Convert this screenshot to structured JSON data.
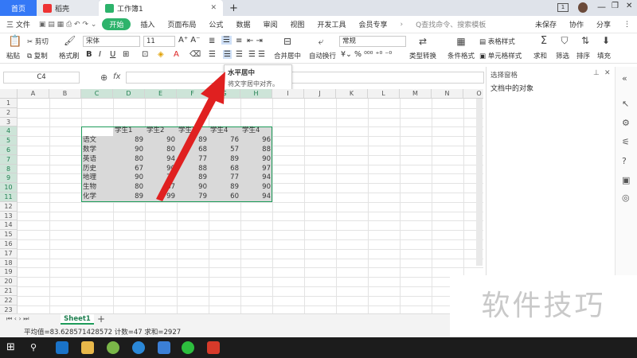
{
  "titlebar": {
    "home_tab": "首页",
    "wps_tab": "稻壳",
    "book_tab": "工作簿1",
    "new_tab": "+",
    "badge": "1"
  },
  "menubar": {
    "file": "三 文件",
    "start": "开始",
    "items": [
      "插入",
      "页面布局",
      "公式",
      "数据",
      "审阅",
      "视图",
      "开发工具",
      "会员专享"
    ],
    "search_placeholder": "Q查找命令、搜索模板",
    "unsaved": "未保存",
    "collab": "协作",
    "share": "分享"
  },
  "toolbar": {
    "paste": "粘贴",
    "cut": "剪切",
    "copy": "复制",
    "format_painter": "格式刷",
    "font_name": "宋体",
    "font_size": "11",
    "merge_center": "合并居中",
    "wrap": "自动换行",
    "number_format": "常规",
    "type_convert": "类型转换",
    "cond_format": "条件格式",
    "table_style": "表格样式",
    "cell_style": "单元格样式",
    "sum": "求和",
    "filter": "筛选",
    "sort": "排序",
    "fill": "填充"
  },
  "tooltip": {
    "title": "水平居中",
    "desc": "将文字居中对齐。"
  },
  "formula_bar": {
    "cell_ref": "C4",
    "fx": "fx"
  },
  "grid": {
    "columns": [
      "A",
      "B",
      "C",
      "D",
      "E",
      "F",
      "G",
      "H",
      "I",
      "J",
      "K",
      "L",
      "M",
      "N",
      "O"
    ],
    "rows": [
      "1",
      "2",
      "3",
      "4",
      "5",
      "6",
      "7",
      "8",
      "9",
      "10",
      "11",
      "12",
      "13",
      "14",
      "15",
      "16",
      "17",
      "18",
      "19",
      "20",
      "21",
      "22",
      "23"
    ],
    "headers": [
      "学生1",
      "学生2",
      "学生3",
      "学生4",
      "学生4"
    ],
    "data": [
      {
        "subject": "语文",
        "values": [
          "89",
          "90",
          "89",
          "76",
          "96"
        ]
      },
      {
        "subject": "数学",
        "values": [
          "90",
          "80",
          "68",
          "57",
          "88"
        ]
      },
      {
        "subject": "英语",
        "values": [
          "80",
          "94",
          "77",
          "89",
          "90"
        ]
      },
      {
        "subject": "历史",
        "values": [
          "67",
          "90",
          "88",
          "68",
          "97"
        ]
      },
      {
        "subject": "地理",
        "values": [
          "90",
          "79",
          "89",
          "77",
          "94"
        ]
      },
      {
        "subject": "生物",
        "values": [
          "80",
          "87",
          "90",
          "89",
          "90"
        ]
      },
      {
        "subject": "化学",
        "values": [
          "89",
          "99",
          "79",
          "60",
          "94"
        ]
      }
    ]
  },
  "right_panel": {
    "title": "选择窗格",
    "subtitle": "文档中的对象"
  },
  "sheet_tabs": {
    "active": "Sheet1",
    "add": "+"
  },
  "status": {
    "summary": "平均值=83.628571428572  计数=47  求和=2927"
  },
  "watermark": "软件技巧",
  "colors": {
    "accent_green": "#2db36b",
    "home_blue": "#3478f6",
    "selection_fill": "#d9d9d9",
    "selection_border": "#1e9c5a",
    "arrow_red": "#e02020"
  }
}
